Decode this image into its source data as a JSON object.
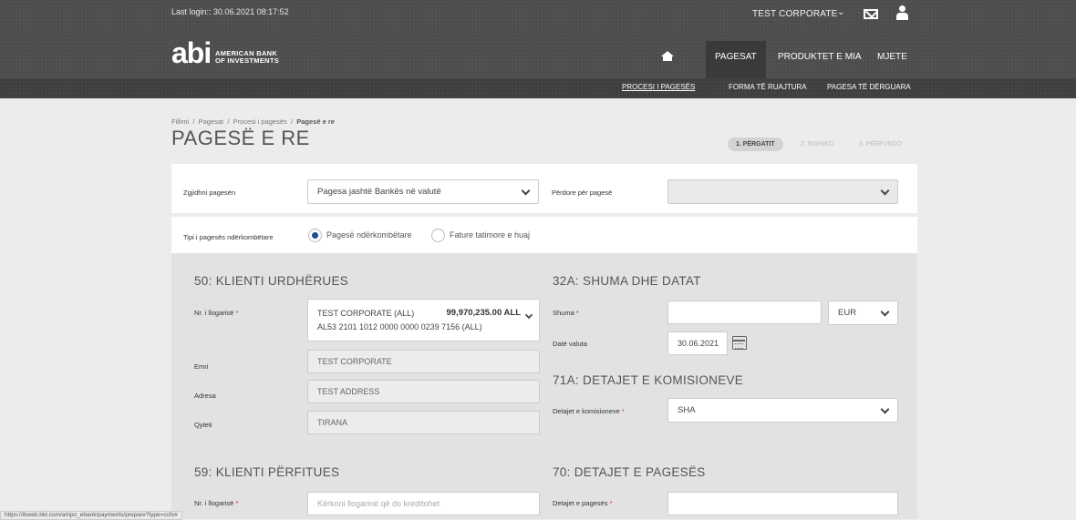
{
  "header": {
    "last_login": "Last login:: 30.06.2021 08:17:52",
    "user": "TEST CORPORATE",
    "logo_abi": "abi",
    "logo_line1": "AMERICAN BANK",
    "logo_line2": "OF INVESTMENTS",
    "nav": [
      "PAGESAT",
      "PRODUKTET E MIA",
      "MJETE"
    ],
    "subnav": [
      "PROCESI I PAGESËS",
      "FORMA TË RUAJTURA",
      "PAGESA TË DËRGUARA"
    ]
  },
  "breadcrumb": {
    "items": [
      "Fillimi",
      "Pagesat",
      "Procesi i pagesës"
    ],
    "current": "Pagesë e re",
    "sep": "/"
  },
  "page_title": "PAGESË E RE",
  "steps": [
    "1. PËRGATIT",
    "2. RISHIKO",
    "3. PËRFUNDO"
  ],
  "payment_select": {
    "label": "Zgjidhni pagesën",
    "value": "Pagesa jashtë Bankës në valutë",
    "use_label": "Përdore për pagesë",
    "use_value": ""
  },
  "intl_type": {
    "label": "Tipi i pagesës ndërkombëtare",
    "options": [
      "Pagesë ndërkombëtare",
      "Fature tatimore e huaj"
    ],
    "selected": "Pagesë ndërkombëtare"
  },
  "ordering": {
    "title": "50: KLIENTI URDHËRUES",
    "account_label": "Nr. i llogarisë",
    "account_name": "TEST CORPORATE (ALL)",
    "account_balance": "99,970,235.00 ALL",
    "account_iban": "AL53 2101 1012 0000 0000 0239 7156 (ALL)",
    "name_label": "Emri",
    "name_value": "TEST CORPORATE",
    "address_label": "Adresa",
    "address_value": "TEST ADDRESS",
    "city_label": "Qyteti",
    "city_value": "TIRANA"
  },
  "amount": {
    "title": "32A: SHUMA DHE DATAT",
    "amount_label": "Shuma",
    "amount_value": "",
    "currency": "EUR",
    "value_date_label": "Datë valuta",
    "value_date": "30.06.2021"
  },
  "commission": {
    "title": "71A: DETAJET E KOMISIONEVE",
    "label": "Detajet e komisioneve",
    "value": "SHA"
  },
  "beneficiary": {
    "title": "59: KLIENTI PËRFITUES",
    "account_label": "Nr. i llogarisë",
    "account_placeholder": "Kërkoni llogarinë që do kreditohet"
  },
  "payment_details": {
    "title": "70: DETAJET E PAGESËS",
    "label": "Detajet e pagesës",
    "value": ""
  },
  "required_mark": "*",
  "status_url": "https://ibweb.bkt.com/ampo_ebank/payments/prepare?type=ccfo#"
}
